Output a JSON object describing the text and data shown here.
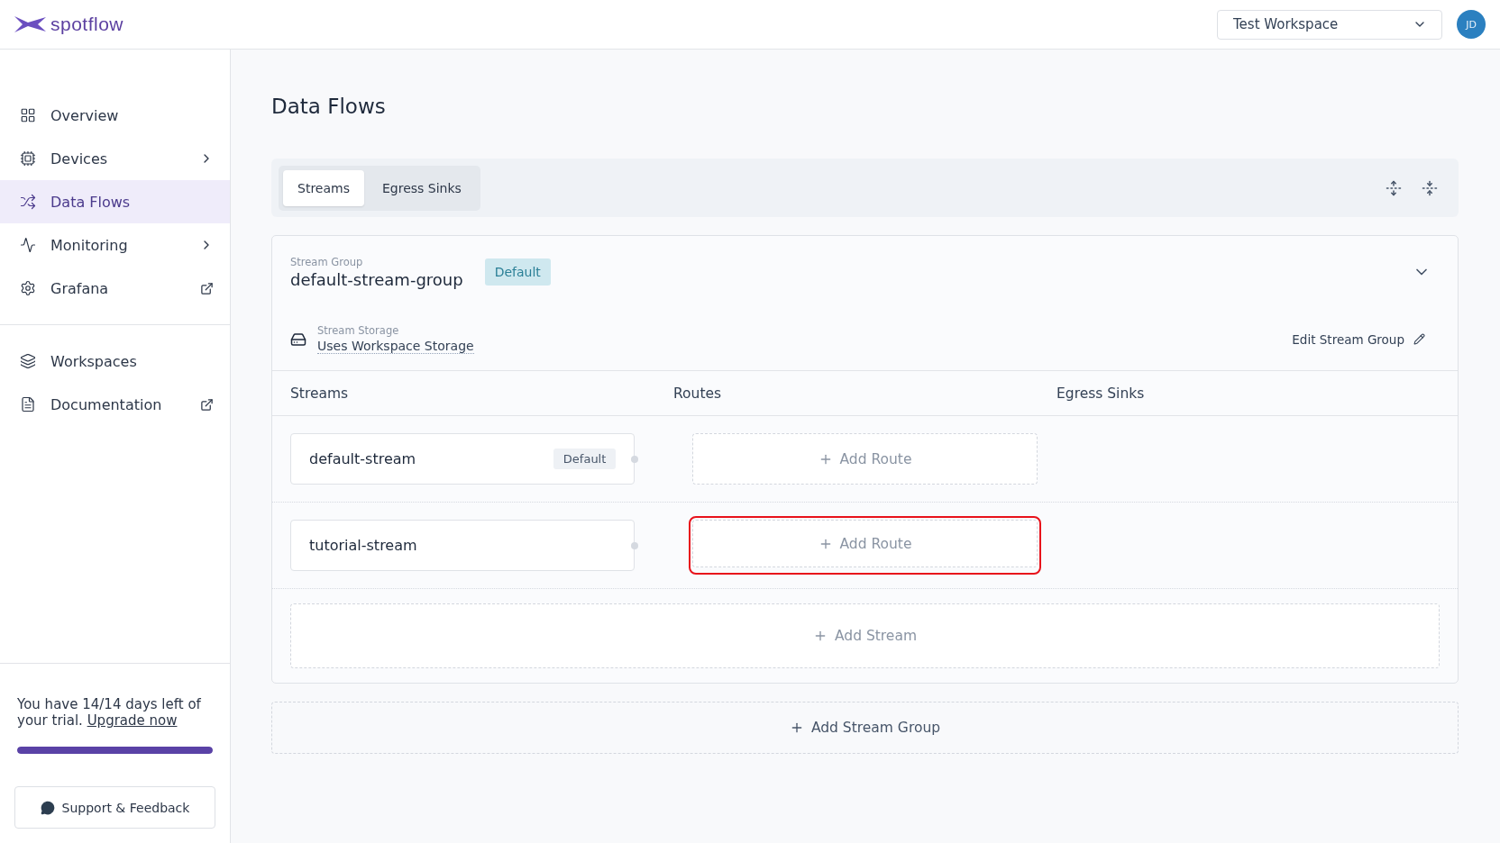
{
  "header": {
    "logo_text": "spotflow",
    "workspace_select": {
      "value": "Test Workspace"
    },
    "avatar": "JD"
  },
  "sidebar": {
    "items": [
      {
        "label": "Overview",
        "kind": "plain",
        "selected": false
      },
      {
        "label": "Devices",
        "kind": "submenu",
        "selected": false
      },
      {
        "label": "Data Flows",
        "kind": "plain",
        "selected": true
      },
      {
        "label": "Monitoring",
        "kind": "submenu",
        "selected": false
      },
      {
        "label": "Grafana",
        "kind": "external",
        "selected": false
      }
    ],
    "secondary_items": [
      {
        "label": "Workspaces",
        "kind": "plain",
        "selected": false
      },
      {
        "label": "Documentation",
        "kind": "external",
        "selected": false
      }
    ],
    "trial": {
      "text": "You have 14/14 days left of your trial.",
      "link": "Upgrade now",
      "level": 1
    },
    "support_button": "Support & Feedback"
  },
  "page": {
    "title": "Data Flows",
    "tabs": [
      {
        "label": "Streams",
        "selected": true
      },
      {
        "label": "Egress Sinks",
        "selected": false
      }
    ],
    "stream_group": {
      "label": "Stream Group",
      "name": "default-stream-group",
      "badge": "Default",
      "expanded": true,
      "storage": {
        "label": "Stream Storage",
        "value": "Uses Workspace Storage"
      },
      "edit_link": "Edit Stream Group",
      "columns": [
        "Streams",
        "Routes",
        "Egress Sinks"
      ],
      "streams": [
        {
          "name": "default-stream",
          "badge": "Default",
          "route_button": "Add Route",
          "highlighted": false
        },
        {
          "name": "tutorial-stream",
          "route_button": "Add Route",
          "highlighted": true
        }
      ],
      "add_stream": "Add Stream"
    },
    "add_stream_group": "Add Stream Group"
  }
}
